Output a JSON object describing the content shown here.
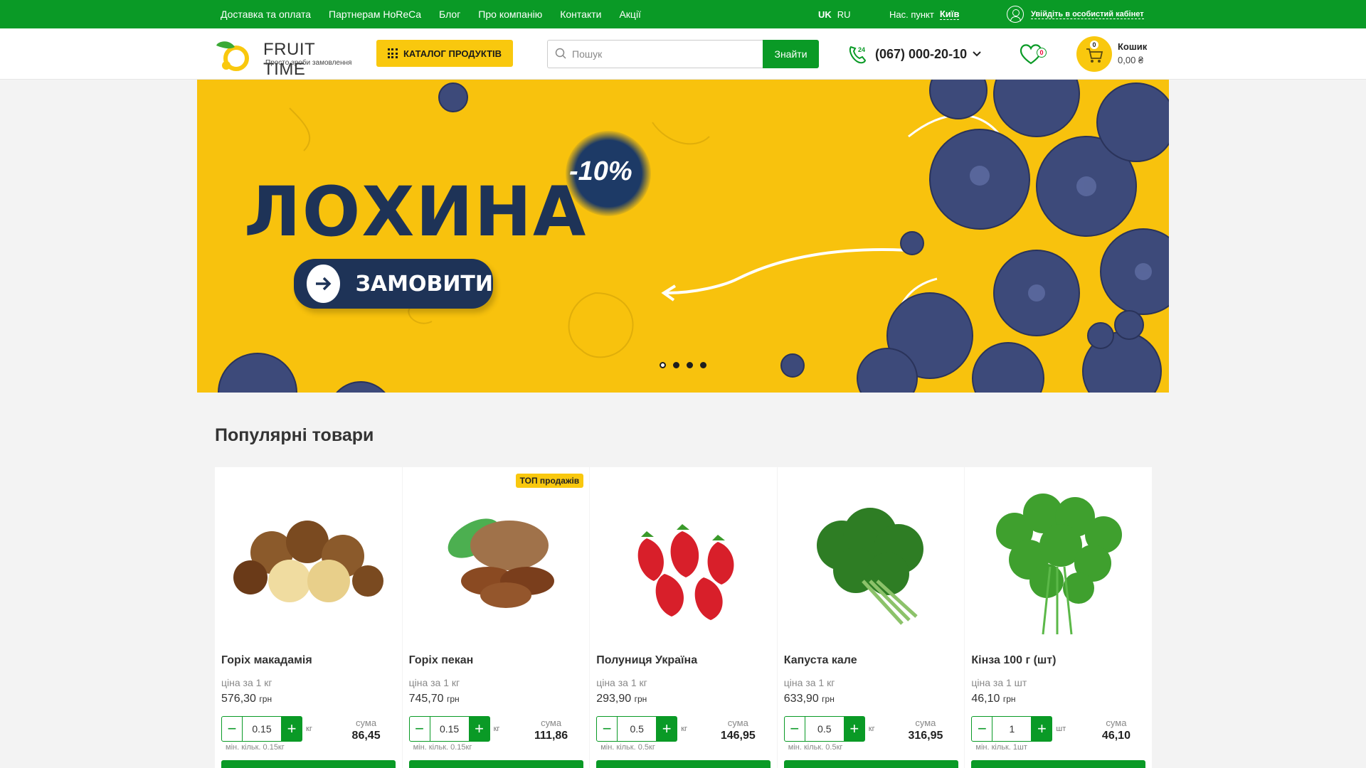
{
  "topbar": {
    "nav": [
      "Доставка та оплата",
      "Партнерам HoReCa",
      "Блог",
      "Про компанію",
      "Контакти",
      "Акції"
    ],
    "lang_active": "UK",
    "lang_sep": "",
    "lang_other": "RU",
    "city_label": "Нас. пункт",
    "city": "Київ",
    "login": "Увійдіть в особистий кабінет"
  },
  "header": {
    "logo_title": "FRUIT TIME",
    "logo_subtitle": "Просто зроби замовлення",
    "catalog_label": "КАТАЛОГ ПРОДУКТІВ",
    "search_placeholder": "Пошук",
    "search_button": "Знайти",
    "phone_badge": "24",
    "phone": "(067) 000-20-10",
    "favorites_count": "0",
    "cart_count": "0",
    "cart_label": "Кошик",
    "cart_sum": "0,00 ₴"
  },
  "banner": {
    "title": "ЛОХИНА",
    "discount": "-10%",
    "button": "ЗАМОВИТИ",
    "slides": 4,
    "active_slide": 1
  },
  "popular": {
    "title": "Популярні товари",
    "sum_label": "сума",
    "currency": "грн",
    "products": [
      {
        "name": "Горіх макадамія",
        "unit_price": "ціна за 1 кг",
        "price": "576,30",
        "qty": "0.15",
        "unit": "кг",
        "sum": "86,45",
        "min": "мін. кільк. 0.15кг",
        "badge": ""
      },
      {
        "name": "Горіх пекан",
        "unit_price": "ціна за 1 кг",
        "price": "745,70",
        "qty": "0.15",
        "unit": "кг",
        "sum": "111,86",
        "min": "мін. кільк. 0.15кг",
        "badge": "ТОП продажів"
      },
      {
        "name": "Полуниця Україна",
        "unit_price": "ціна за 1 кг",
        "price": "293,90",
        "qty": "0.5",
        "unit": "кг",
        "sum": "146,95",
        "min": "мін. кільк. 0.5кг",
        "badge": ""
      },
      {
        "name": "Капуста кале",
        "unit_price": "ціна за 1 кг",
        "price": "633,90",
        "qty": "0.5",
        "unit": "кг",
        "sum": "316,95",
        "min": "мін. кільк. 0.5кг",
        "badge": ""
      },
      {
        "name": "Кінза 100 г (шт)",
        "unit_price": "ціна за 1 шт",
        "price": "46,10",
        "qty": "1",
        "unit": "шт",
        "sum": "46,10",
        "min": "мін. кільк. 1шт",
        "badge": ""
      }
    ]
  },
  "colors": {
    "brand_green": "#0a9a26",
    "accent_yellow": "#f9c80e",
    "navy": "#1e3357"
  }
}
